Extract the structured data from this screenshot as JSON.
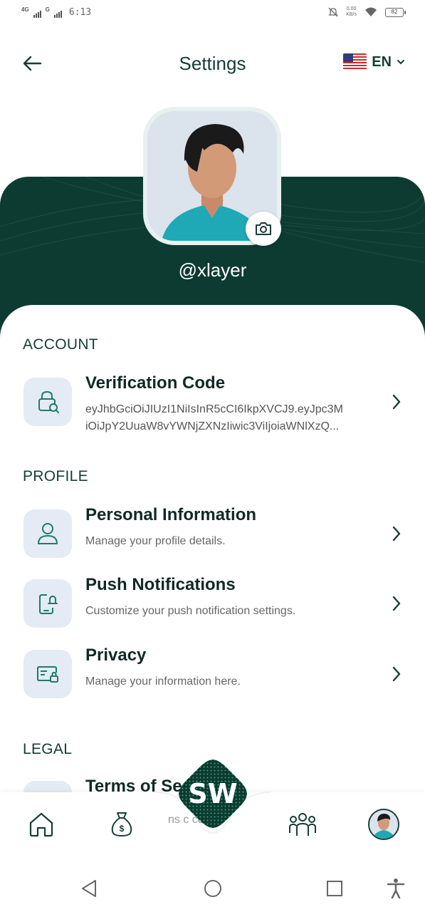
{
  "status_bar": {
    "network1": "4G",
    "network2": "G",
    "time": "6:13",
    "speed_value": "0.00",
    "speed_unit": "KB/s",
    "battery": "82"
  },
  "header": {
    "title": "Settings",
    "language": "EN",
    "back_icon": "arrow-left-icon",
    "flag_icon": "us-flag-icon"
  },
  "profile": {
    "username": "@xlayer"
  },
  "sections": {
    "account": "ACCOUNT",
    "profile": "PROFILE",
    "legal": "LEGAL"
  },
  "account_items": {
    "verification": {
      "title": "Verification Code",
      "line1": "eyJhbGciOiJIUzI1NiIsInR5cCI6IkpXVCJ9.eyJpc3M",
      "line2": "iOiJpY2UuaW8vYWNjZXNzIiwic3ViIjoiaWNlXzQ...",
      "icon": "lock-search-icon"
    }
  },
  "profile_items": {
    "personal": {
      "title": "Personal Information",
      "subtitle": "Manage your profile details.",
      "icon": "person-icon"
    },
    "push": {
      "title": "Push Notifications",
      "subtitle": "Customize your push notification settings.",
      "icon": "phone-bell-icon"
    },
    "privacy": {
      "title": "Privacy",
      "subtitle": "Manage your information here.",
      "icon": "id-card-lock-icon"
    }
  },
  "legal_items": {
    "terms_partial": "Terms of Se",
    "behind_text": "ns c      ce"
  },
  "bottom_nav": {
    "logo_text": "SW",
    "items": [
      "home-icon",
      "money-bag-icon",
      "team-icon",
      "profile-avatar"
    ]
  },
  "colors": {
    "brand_dark": "#0d3b32",
    "text_dark": "#0f2a24",
    "icon_bg": "#e4ebf5",
    "accent_teal": "#1f7a69"
  }
}
